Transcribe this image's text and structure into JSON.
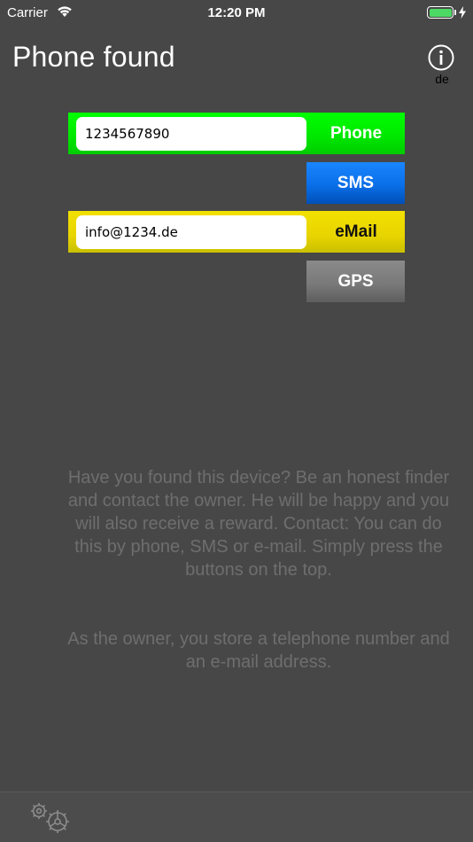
{
  "status_bar": {
    "carrier": "Carrier",
    "time": "12:20 PM",
    "battery_level": 1.0
  },
  "header": {
    "title": "Phone found",
    "info_icon": "info-icon",
    "language": "de"
  },
  "contact": {
    "phone_value": "1234567890",
    "phone_label": "Phone",
    "sms_label": "SMS",
    "email_value": "info@1234.de",
    "email_label": "eMail",
    "gps_label": "GPS"
  },
  "colors": {
    "background": "#474747",
    "phone_green": "#00ff00",
    "sms_blue": "#0a6fe8",
    "email_yellow": "#e8d400",
    "gps_gray": "#7a7a7a",
    "info_text": "#6e6e6e"
  },
  "message": {
    "paragraph1": "Have you found this device? Be an honest finder and contact the owner. He will be happy and you will also receive a reward. Contact: You can do this by phone, SMS or e-mail. Simply press the buttons on the top.",
    "paragraph2": "As the owner, you store a telephone number and an e-mail address."
  },
  "toolbar": {
    "settings_icon": "gears-icon"
  }
}
